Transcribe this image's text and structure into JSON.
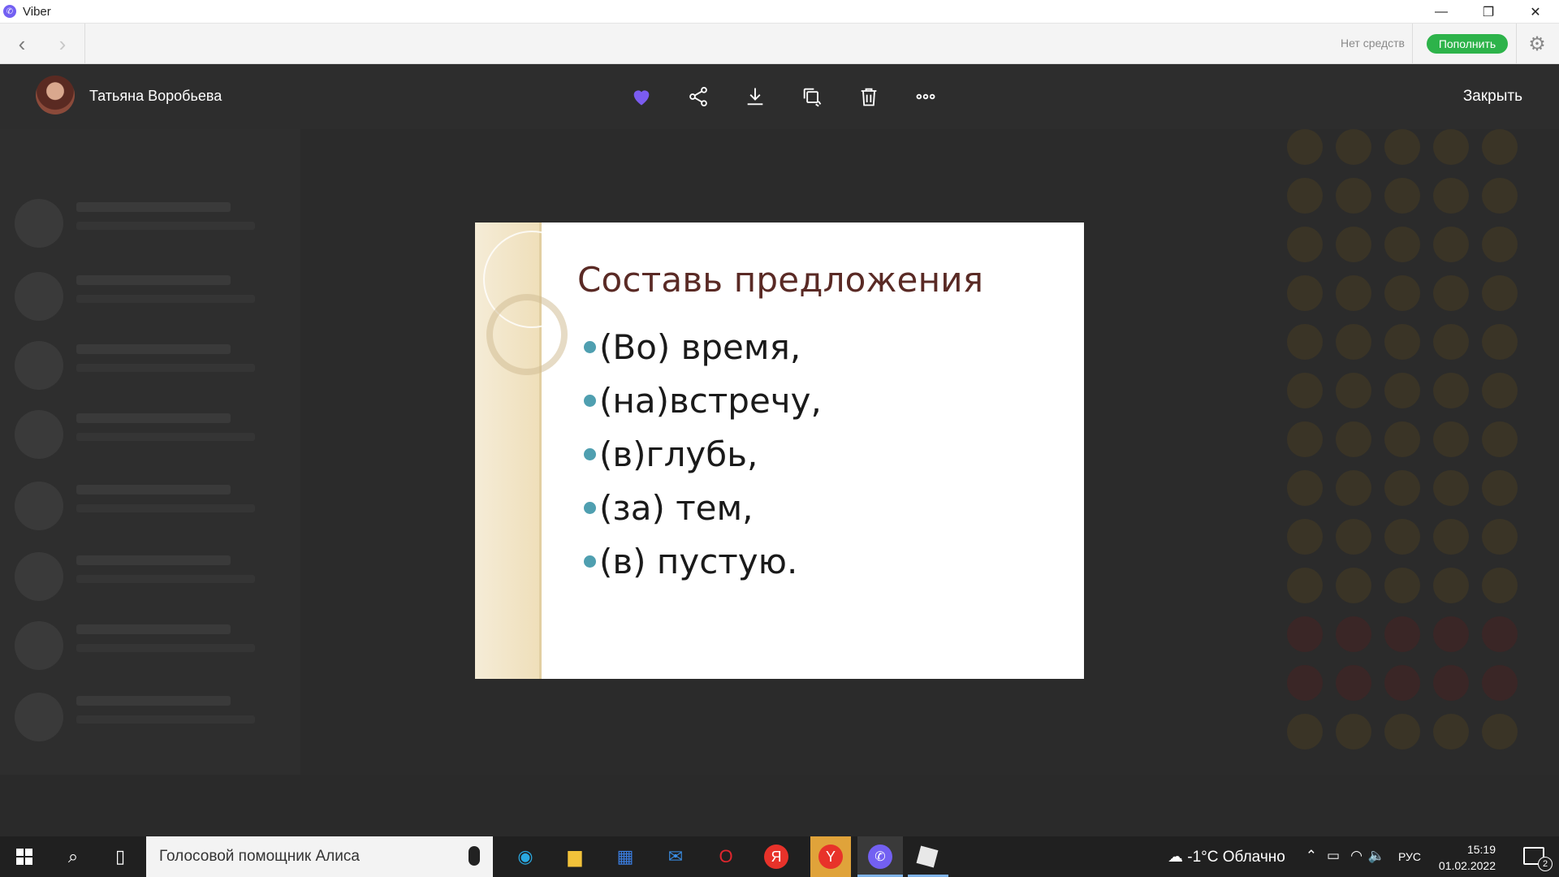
{
  "window": {
    "app_title": "Viber"
  },
  "toolbar": {
    "balance_text": "Нет средств",
    "topup_label": "Пополнить"
  },
  "viewer": {
    "sender_name": "Татьяна Воробьева",
    "close_label": "Закрыть"
  },
  "slide": {
    "title": "Составь предложения",
    "items": [
      "(Во) время,",
      "(на)встречу,",
      "(в)глубь,",
      "(за) тем,",
      "(в) пустую."
    ]
  },
  "taskbar": {
    "search_text": "Голосовой помощник Алиса",
    "weather": "-1°C Облачно",
    "language": "РУС",
    "time": "15:19",
    "date": "01.02.2022",
    "notifications_count": "2"
  },
  "colors": {
    "accent": "#7360f2",
    "topup": "#2db34a",
    "bullet": "#4f9fb0",
    "slide_title": "#5a2a25"
  }
}
